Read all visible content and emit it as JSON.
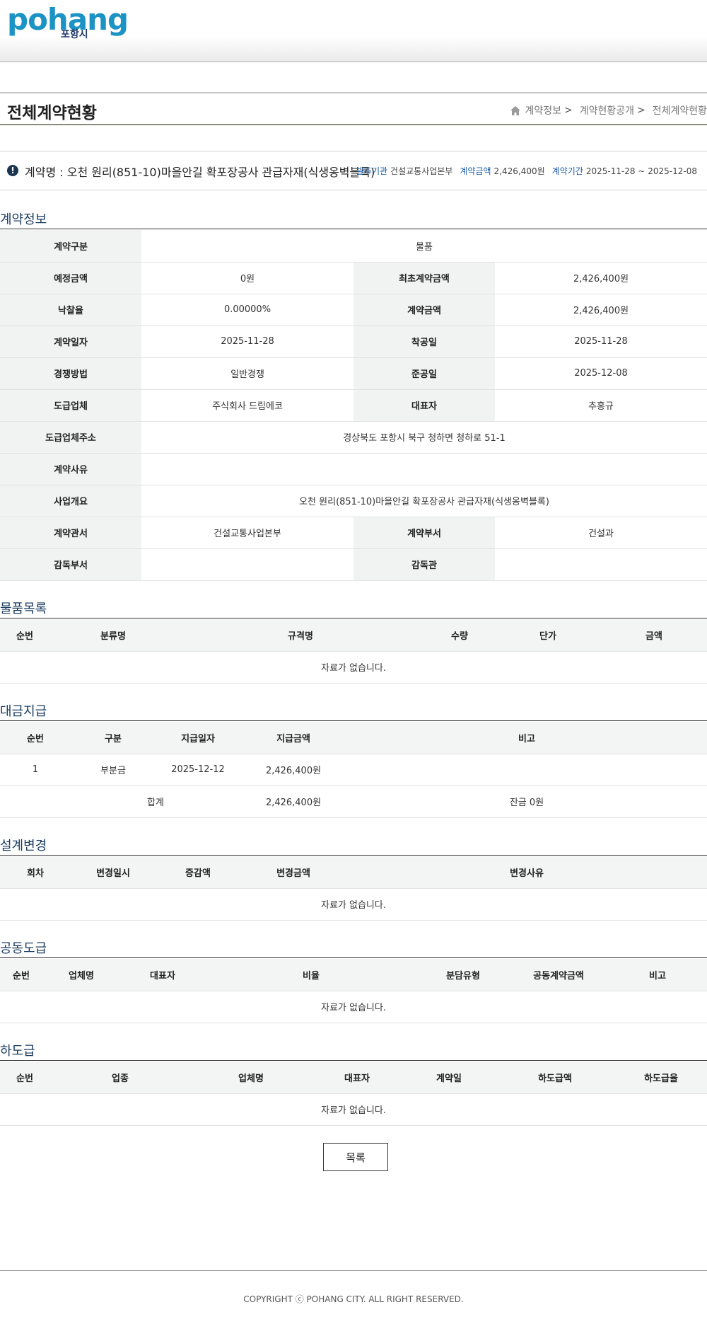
{
  "logo": {
    "word": "pohang",
    "sub": "포항시"
  },
  "page_title": "전체계약현황",
  "breadcrumb": [
    "계약정보",
    "계약현황공개",
    "전체계약현황"
  ],
  "breadcrumb_sep": ">",
  "summary": {
    "contract_name": "계약명 : 오천 원리(851-10)마을안길 확포장공사 관급자재(식생옹벽블록)",
    "orderer_label": "발주기관",
    "orderer": "건설교통사업본부",
    "amount_label": "계약금액",
    "amount": "2,426,400원",
    "period_label": "계약기간",
    "period": "2025-11-28 ~ 2025-12-08"
  },
  "sections": {
    "info": "계약정보",
    "goods": "물품목록",
    "payment": "대금지급",
    "design": "설계변경",
    "joint": "공동도급",
    "sub": "하도급"
  },
  "info": {
    "type_label": "계약구분",
    "type": "물품",
    "est_label": "예정금액",
    "est": "0원",
    "first_label": "최초계약금액",
    "first": "2,426,400원",
    "rate_label": "낙찰율",
    "rate": "0.00000%",
    "amount_label": "계약금액",
    "amount": "2,426,400원",
    "date_label": "계약일자",
    "date": "2025-11-28",
    "start_label": "착공일",
    "start": "2025-11-28",
    "method_label": "경쟁방법",
    "method": "일반경쟁",
    "end_label": "준공일",
    "end": "2025-12-08",
    "company_label": "도급업체",
    "company": "주식회사 드림에코",
    "ceo_label": "대표자",
    "ceo": "추홍규",
    "address_label": "도급업체주소",
    "address": "경상북도 포항시 북구 청하면 청하로 51-1",
    "reason_label": "계약사유",
    "reason": "",
    "overview_label": "사업개요",
    "overview": "오천 원리(851-10)마을안길 확포장공사 관급자재(식생옹벽블록)",
    "office_label": "계약관서",
    "office": "건설교통사업본부",
    "dept_label": "계약부서",
    "dept": "건설과",
    "sup_dept_label": "감독부서",
    "sup_dept": "",
    "supervisor_label": "감독관",
    "supervisor": ""
  },
  "goods": {
    "headers": [
      "순번",
      "분류명",
      "규격명",
      "수량",
      "단가",
      "금액"
    ],
    "empty": "자료가 없습니다."
  },
  "payment": {
    "headers": [
      "순번",
      "구분",
      "지급일자",
      "지급금액",
      "비고"
    ],
    "rows": [
      [
        "1",
        "부분금",
        "2025-12-12",
        "2,426,400원",
        ""
      ]
    ],
    "total_label": "합계",
    "total": "2,426,400원",
    "balance": "잔금 0원"
  },
  "design": {
    "headers": [
      "회차",
      "변경일시",
      "증감액",
      "변경금액",
      "변경사유"
    ],
    "empty": "자료가 없습니다."
  },
  "joint": {
    "headers": [
      "순번",
      "업체명",
      "대표자",
      "비율",
      "분담유형",
      "공동계약금액",
      "비고"
    ],
    "empty": "자료가 없습니다."
  },
  "sub": {
    "headers": [
      "순번",
      "업종",
      "업체명",
      "대표자",
      "계약일",
      "하도급액",
      "하도급율"
    ],
    "empty": "자료가 없습니다."
  },
  "list_button": "목록",
  "copyright": "COPYRIGHT ⓒ POHANG CITY. ALL RIGHT RESERVED."
}
